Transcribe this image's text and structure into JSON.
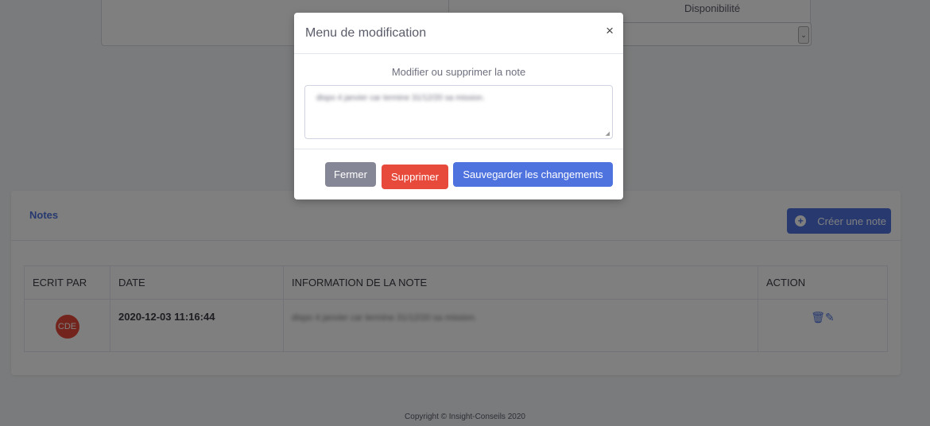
{
  "background": {
    "dispo_label": "Disponibilité",
    "notes": {
      "title": "Notes",
      "create_label": "Créer une note",
      "columns": [
        "ECRIT PAR",
        "DATE",
        "INFORMATION DE LA NOTE",
        "ACTION"
      ],
      "rows": [
        {
          "author_initials": "CDE",
          "date": "2020-12-03 11:16:44",
          "info": "dispo 4 janvier car termine 31/12/20 sa mission."
        }
      ]
    },
    "copyright": "Copyright © Insight-Conseils 2020"
  },
  "modal": {
    "title": "Menu de modification",
    "close_symbol": "×",
    "subtitle": "Modifier ou supprimer la note",
    "note_value": "dispo 4 janvier car termine 31/12/20 sa mission.",
    "buttons": {
      "close": "Fermer",
      "delete": "Supprimer",
      "save": "Sauvegarder les changements"
    }
  },
  "colors": {
    "primary": "#4e73df",
    "danger": "#e74a3b",
    "secondary": "#858796"
  }
}
